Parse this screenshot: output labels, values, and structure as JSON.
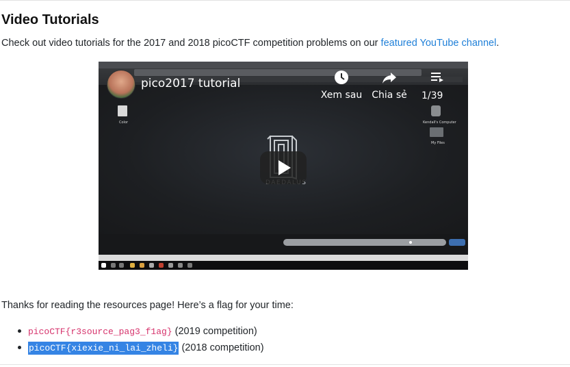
{
  "section": {
    "title": "Video Tutorials",
    "intro_text": "Check out video tutorials for the 2017 and 2018 picoCTF competition problems on our ",
    "link_text": "featured YouTube channel",
    "intro_suffix": "."
  },
  "video": {
    "title": "pico2017 tutorial",
    "watch_later_label": "Xem sau",
    "share_label": "Chia sẻ",
    "playlist_count": "1/39",
    "splash_text": "DAEDALUS",
    "desktop_icon_label": "Color",
    "desktop_right_label1": "Kendall's Computer",
    "desktop_right_label2": "My Files"
  },
  "thanks_text": "Thanks for reading the resources page! Here’s a flag for your time:",
  "flags": [
    {
      "code": "picoCTF{r3source_pag3_f1ag}",
      "note": " (2019 competition)",
      "selected": false
    },
    {
      "code": "picoCTF{xiexie_ni_lai_zheli}",
      "note": " (2018 competition)",
      "selected": true
    }
  ],
  "colors": {
    "link": "#1e7fd8",
    "code": "#d6336c",
    "selection": "#3584e4"
  }
}
